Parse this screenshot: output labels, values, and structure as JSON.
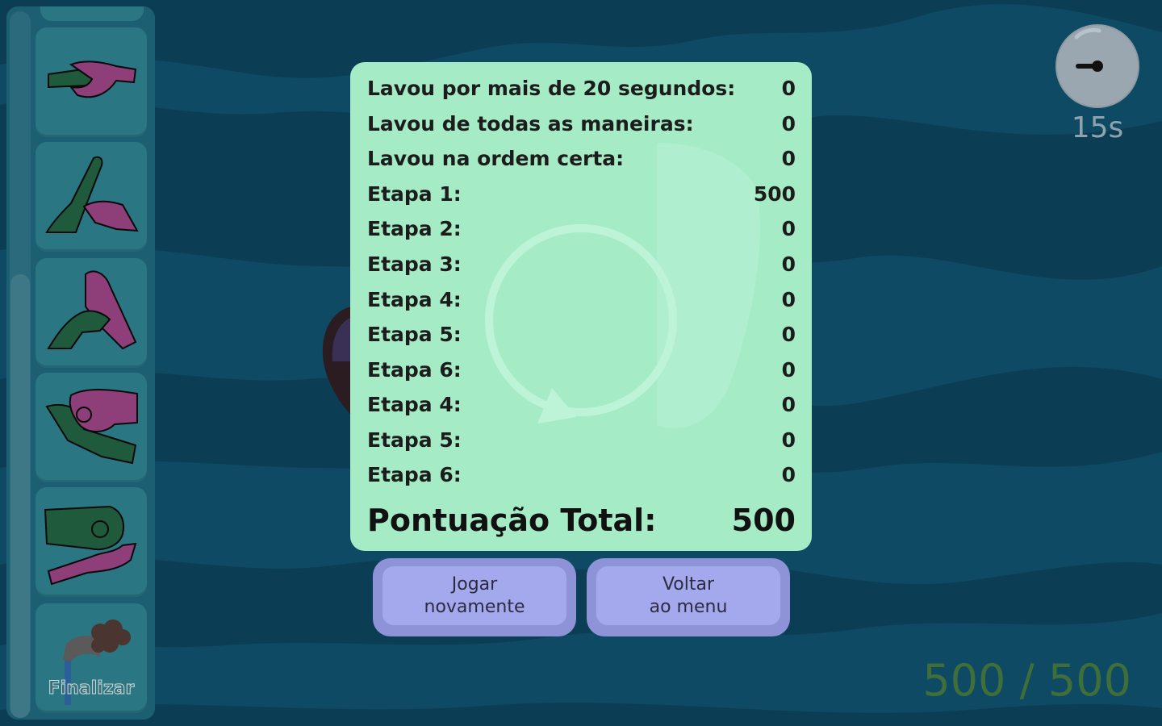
{
  "colors": {
    "background": "#0f4c66",
    "panel": "#a5ecc6",
    "button": "#a4a9ee",
    "score": "#3f6e3b",
    "hand_green": "#1f5a3c",
    "hand_magenta": "#8e3e78"
  },
  "sidebar": {
    "steps": [
      {
        "icon": "handwash-palms-icon"
      },
      {
        "icon": "handwash-back-of-hand-icon"
      },
      {
        "icon": "handwash-fingers-interlaced-icon"
      },
      {
        "icon": "handwash-fingertips-icon"
      },
      {
        "icon": "handwash-thumbs-icon"
      }
    ],
    "finalize": {
      "icon": "faucet-icon",
      "label": "Finalizar"
    }
  },
  "results": {
    "rows": [
      {
        "label": "Lavou por mais de 20 segundos:",
        "value": "0"
      },
      {
        "label": "Lavou de todas as maneiras:",
        "value": "0"
      },
      {
        "label": "Lavou na ordem certa:",
        "value": "0"
      },
      {
        "label": "Etapa 1:",
        "value": "500"
      },
      {
        "label": "Etapa 2:",
        "value": "0"
      },
      {
        "label": "Etapa 3:",
        "value": "0"
      },
      {
        "label": "Etapa 4:",
        "value": "0"
      },
      {
        "label": "Etapa 5:",
        "value": "0"
      },
      {
        "label": "Etapa 6:",
        "value": "0"
      },
      {
        "label": "Etapa 4:",
        "value": "0"
      },
      {
        "label": "Etapa 5:",
        "value": "0"
      },
      {
        "label": "Etapa 6:",
        "value": "0"
      }
    ],
    "total_label": "Pontuação Total:",
    "total_value": "500"
  },
  "buttons": {
    "play_again": "Jogar\nnovamente",
    "back_to_menu": "Voltar\nao menu"
  },
  "timer": {
    "icon": "stopwatch-icon",
    "text": "15s",
    "progress": 0.25
  },
  "score": {
    "text": "500 / 500"
  }
}
